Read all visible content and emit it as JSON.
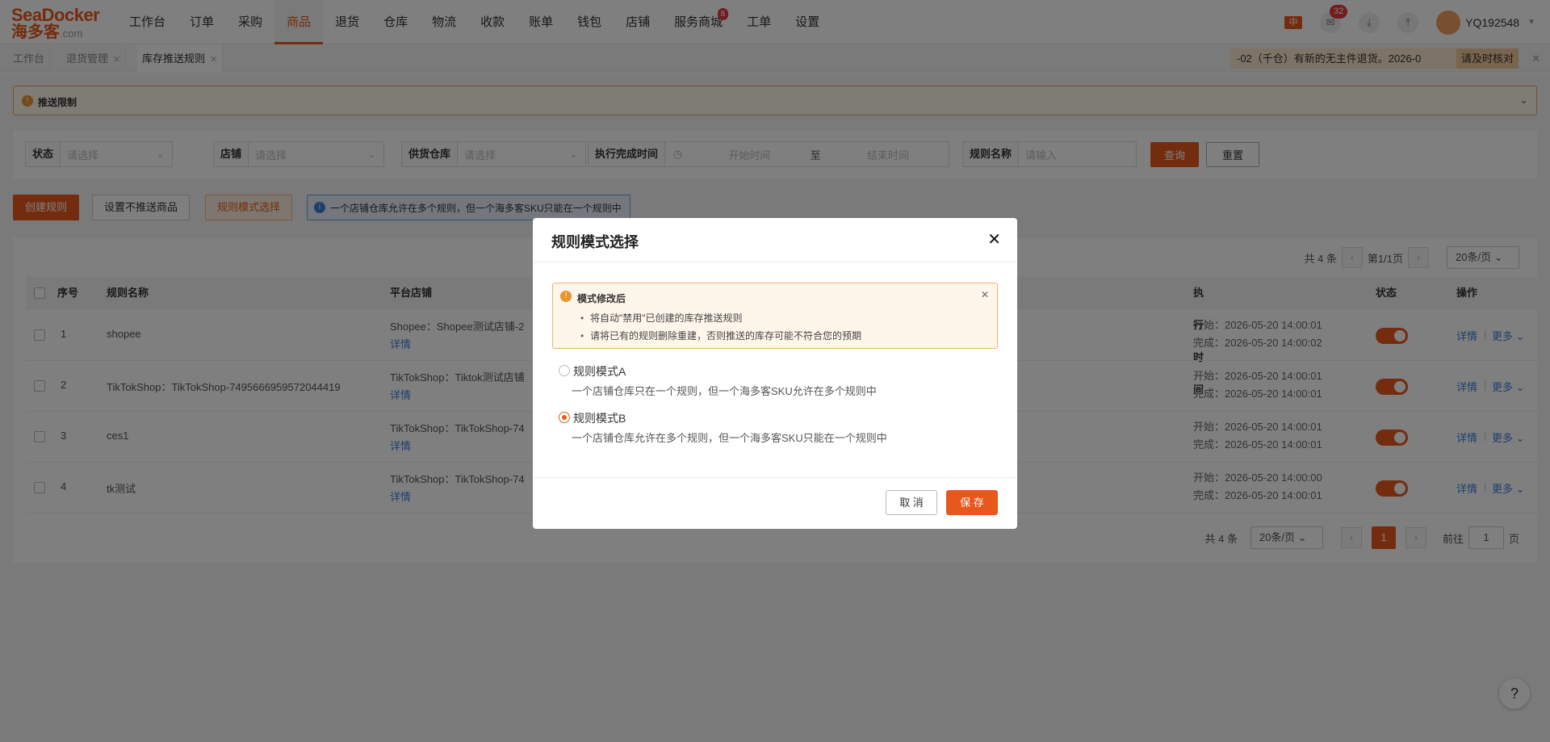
{
  "brand": {
    "line1": "SeaDocker",
    "line2": "海多客",
    "suffix": ".com"
  },
  "nav": {
    "items": [
      {
        "label": "工作台"
      },
      {
        "label": "订单"
      },
      {
        "label": "采购"
      },
      {
        "label": "商品"
      },
      {
        "label": "退货"
      },
      {
        "label": "仓库"
      },
      {
        "label": "物流"
      },
      {
        "label": "收款"
      },
      {
        "label": "账单"
      },
      {
        "label": "钱包"
      },
      {
        "label": "店铺"
      },
      {
        "label": "服务商城"
      },
      {
        "label": "工单"
      },
      {
        "label": "设置"
      }
    ],
    "active_index": 3,
    "service_badge": "8"
  },
  "header_right": {
    "lang": "中",
    "notify_count": "32",
    "username": "YQ192548"
  },
  "tabs": [
    {
      "label": "工作台"
    },
    {
      "label": "退货管理"
    },
    {
      "label": "库存推送规则"
    }
  ],
  "notice": {
    "text": "-02（千仓）有新的无主件退货。2026-0",
    "action": "请及时核对"
  },
  "limit_bar": {
    "title": "推送限制"
  },
  "filters": {
    "status": {
      "label": "状态",
      "placeholder": "请选择"
    },
    "store": {
      "label": "店铺",
      "placeholder": "请选择"
    },
    "warehouse": {
      "label": "供货仓库",
      "placeholder": "请选择"
    },
    "time": {
      "label": "执行完成时间",
      "start": "开始时间",
      "sep": "至",
      "end": "结束时间"
    },
    "rule_name": {
      "label": "规则名称",
      "placeholder": "请输入"
    },
    "query": "查询",
    "reset": "重置"
  },
  "actions": {
    "create": "创建规则",
    "no_push": "设置不推送商品",
    "mode_select": "规则模式选择",
    "info": "一个店铺仓库允许在多个规则，但一个海多客SKU只能在一个规则中"
  },
  "pager_top": {
    "total": "共 4 条",
    "page": "第1/1页",
    "size": "20条/页"
  },
  "table": {
    "headers": [
      "序号",
      "规则名称",
      "平台店铺",
      "执行时间",
      "状态",
      "操作"
    ],
    "start_label": "开始：",
    "finish_label": "完成：",
    "detail": "详情",
    "more": "更多",
    "rows": [
      {
        "idx": "1",
        "name": "shopee",
        "store": "Shopee：Shopee测试店铺-2",
        "start": "2026-05-20 14:00:01",
        "finish": "2026-05-20 14:00:02"
      },
      {
        "idx": "2",
        "name": "TikTokShop：TikTokShop-7495666959572044419",
        "store": "TikTokShop：Tiktok测试店铺",
        "start": "2026-05-20 14:00:01",
        "finish": "2026-05-20 14:00:01"
      },
      {
        "idx": "3",
        "name": "ces1",
        "store": "TikTokShop：TikTokShop-74",
        "start": "2026-05-20 14:00:01",
        "finish": "2026-05-20 14:00:01"
      },
      {
        "idx": "4",
        "name": "tk测试",
        "store": "TikTokShop：TikTokShop-74",
        "start": "2026-05-20 14:00:00",
        "finish": "2026-05-20 14:00:01"
      }
    ]
  },
  "pager_bottom": {
    "total": "共 4 条",
    "size": "20条/页",
    "current": "1",
    "goto": "前往",
    "goto_value": "1",
    "page_unit": "页"
  },
  "modal": {
    "title": "规则模式选择",
    "alert_title": "模式修改后",
    "alert_items": [
      "将自动\"禁用\"已创建的库存推送规则",
      "请将已有的规则删除重建，否则推送的库存可能不符合您的预期"
    ],
    "option_a": {
      "label": "规则模式A",
      "desc": "一个店铺仓库只在一个规则，但一个海多客SKU允许在多个规则中"
    },
    "option_b": {
      "label": "规则模式B",
      "desc": "一个店铺仓库允许在多个规则，但一个海多客SKU只能在一个规则中"
    },
    "selected": "B",
    "cancel": "取 消",
    "save": "保 存"
  },
  "help": "?"
}
